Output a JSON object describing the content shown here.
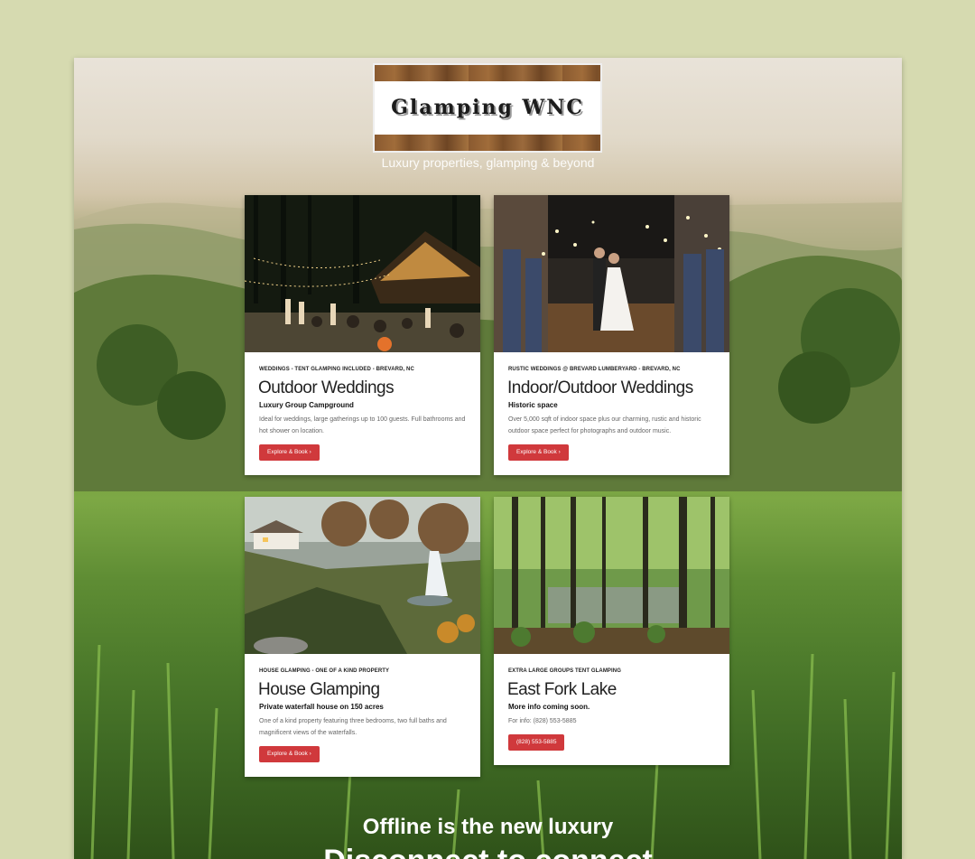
{
  "header": {
    "logo_text": "Glamping WNC",
    "tagline": "Luxury properties, glamping & beyond"
  },
  "cards": [
    {
      "kicker": "WEDDINGS - TENT GLAMPING INCLUDED - BREVARD, NC",
      "title": "Outdoor Weddings",
      "subtitle": "Luxury Group Campground",
      "description": "Ideal for weddings, large gatherings up to 100 guests. Full bathrooms and hot shower on location.",
      "button": "Explore & Book ›"
    },
    {
      "kicker": "RUSTIC WEDDINGS @ BREVARD LUMBERYARD - BREVARD, NC",
      "title": "Indoor/Outdoor Weddings",
      "subtitle": "Historic space",
      "description": "Over 5,000 sqft of indoor space plus our charming, rustic and historic outdoor space perfect for photographs and outdoor music.",
      "button": "Explore & Book ›"
    },
    {
      "kicker": "HOUSE GLAMPING - ONE OF A KIND PROPERTY",
      "title": "House Glamping",
      "subtitle": "Private waterfall house on 150 acres",
      "description": "One of a kind property featuring three bedrooms, two full baths and magnificent views of the waterfalls.",
      "button": "Explore & Book ›"
    },
    {
      "kicker": "EXTRA LARGE GROUPS TENT GLAMPING",
      "title": "East Fork Lake",
      "subtitle": "More info coming soon.",
      "description": "For info: (828) 553-5885",
      "button": "(828) 553-5885"
    }
  ],
  "footer": {
    "line1": "Offline is the new luxury",
    "line2": "Disconnect to connect"
  },
  "colors": {
    "page_background": "#d6dab0",
    "button": "#d0393c",
    "card": "#ffffff"
  }
}
